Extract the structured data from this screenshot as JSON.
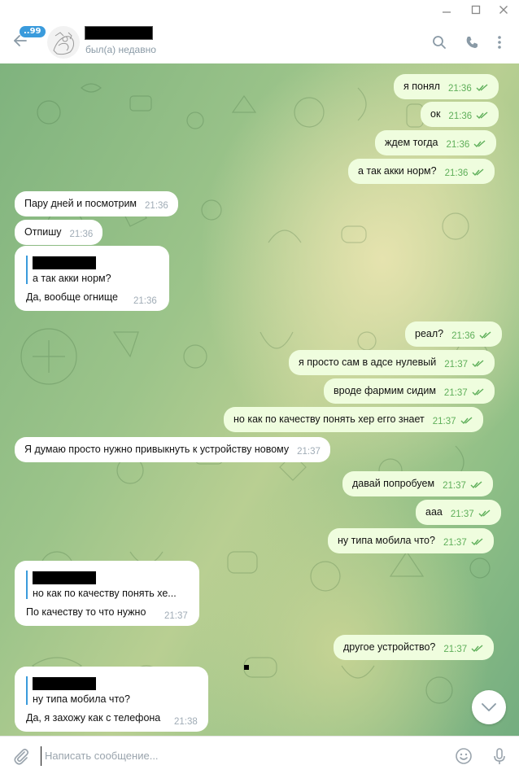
{
  "window": {
    "minimize_icon": "minimize-icon",
    "maximize_icon": "maximize-icon",
    "close_icon": "close-icon"
  },
  "header": {
    "unread_count": "..99",
    "status": "был(а) недавно"
  },
  "messages": [
    {
      "dir": "out",
      "text": "я понял",
      "time": "21:36"
    },
    {
      "dir": "out",
      "text": "ок",
      "time": "21:36"
    },
    {
      "dir": "out",
      "text": "ждем тогда",
      "time": "21:36"
    },
    {
      "dir": "out",
      "text": "а так акки норм?",
      "time": "21:36"
    },
    {
      "dir": "in",
      "text": "Пару дней и посмотрим",
      "time": "21:36"
    },
    {
      "dir": "in",
      "text": "Отпишу",
      "time": "21:36"
    },
    {
      "dir": "in",
      "reply_to": "а так акки норм?",
      "text": "Да, вообще огнище",
      "time": "21:36"
    },
    {
      "dir": "out",
      "text": "реал?",
      "time": "21:36"
    },
    {
      "dir": "out",
      "text": "я просто сам в адсе нулевый",
      "time": "21:37"
    },
    {
      "dir": "out",
      "text": "вроде фармим сидим",
      "time": "21:37"
    },
    {
      "dir": "out",
      "text": "но как по качеству понять хер егго знает",
      "time": "21:37"
    },
    {
      "dir": "in",
      "text": "Я думаю просто нужно привыкнуть к устройству новому",
      "time": "21:37"
    },
    {
      "dir": "out",
      "text": "давай попробуем",
      "time": "21:37"
    },
    {
      "dir": "out",
      "text": "ааа",
      "time": "21:37"
    },
    {
      "dir": "out",
      "text": "ну типа мобила что?",
      "time": "21:37"
    },
    {
      "dir": "in",
      "reply_to": "но как по качеству понять хе...",
      "text": "По качеству то что нужно",
      "time": "21:37"
    },
    {
      "dir": "out",
      "text": "другое устройство?",
      "time": "21:37"
    },
    {
      "dir": "in",
      "reply_to": "ну типа мобила что?",
      "text": "Да, я захожу как с телефона",
      "time": "21:38"
    }
  ],
  "composer": {
    "placeholder": "Написать сообщение..."
  },
  "colors": {
    "outgoing_bubble": "#effdde",
    "incoming_bubble": "#ffffff",
    "accent": "#3a9bdc",
    "read_check": "#5faf5a"
  }
}
